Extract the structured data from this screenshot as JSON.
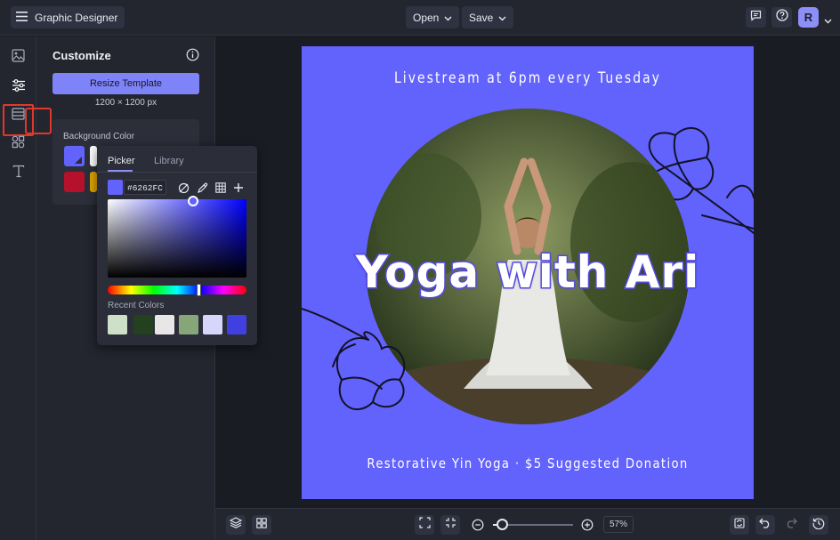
{
  "app": {
    "title": "Graphic Designer"
  },
  "toolbar": {
    "open_label": "Open",
    "save_label": "Save",
    "avatar_initial": "R"
  },
  "panel": {
    "title": "Customize",
    "resize_label": "Resize Template",
    "dimensions": "1200 × 1200 px",
    "background_color_label": "Background Color",
    "swatches": [
      "#6262fc",
      "#ffffff",
      "#b5102c",
      "#e0a400"
    ]
  },
  "picker": {
    "tabs": [
      "Picker",
      "Library"
    ],
    "hex_value": "#6262FC",
    "hue_fraction": 0.66,
    "recent_label": "Recent Colors",
    "recent_colors": [
      "#cfe0c8",
      "#23401f",
      "#e8e6e6",
      "#86a67a",
      "#d6d6fb",
      "#4040e0"
    ]
  },
  "design": {
    "background": "#6262fc",
    "top_text": "Livestream at 6pm every Tuesday",
    "headline": "Yoga with Ari",
    "bottom_text": "Restorative Yin Yoga · $5 Suggested Donation"
  },
  "bottombar": {
    "zoom_label": "57%",
    "zoom_fraction": 0.57
  }
}
